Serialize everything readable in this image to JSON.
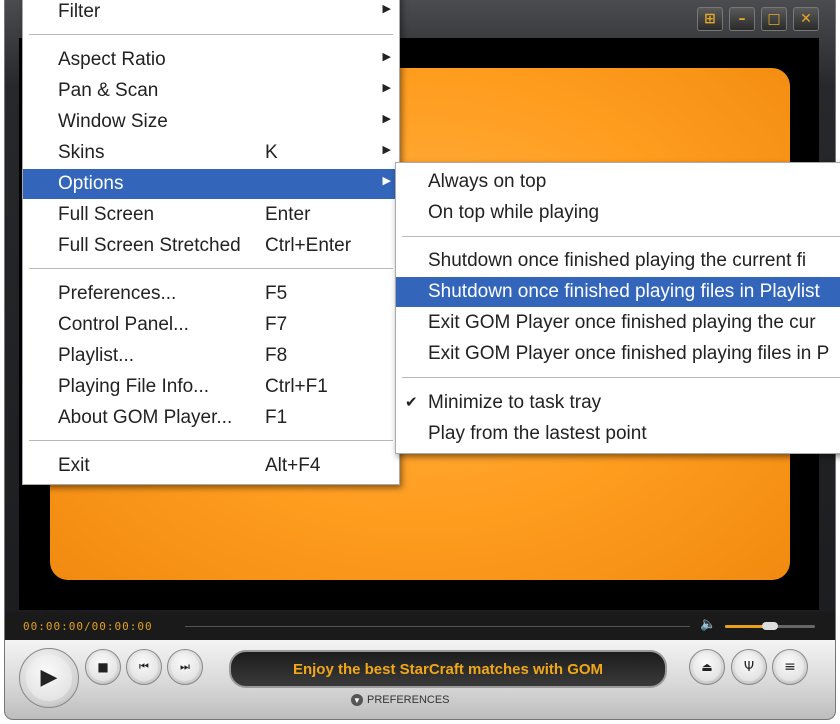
{
  "menu": {
    "items": [
      {
        "label": "Filter",
        "shortcut": "",
        "submenu": true
      },
      {
        "label": "Aspect Ratio",
        "shortcut": "",
        "submenu": true
      },
      {
        "label": "Pan & Scan",
        "shortcut": "",
        "submenu": true
      },
      {
        "label": "Window Size",
        "shortcut": "",
        "submenu": true
      },
      {
        "label": "Skins",
        "shortcut": "K",
        "submenu": true
      },
      {
        "label": "Options",
        "shortcut": "",
        "submenu": true,
        "highlighted": true
      },
      {
        "label": "Full Screen",
        "shortcut": "Enter"
      },
      {
        "label": "Full Screen Stretched",
        "shortcut": "Ctrl+Enter"
      },
      {
        "label": "Preferences...",
        "shortcut": "F5"
      },
      {
        "label": "Control Panel...",
        "shortcut": "F7"
      },
      {
        "label": "Playlist...",
        "shortcut": "F8"
      },
      {
        "label": "Playing File Info...",
        "shortcut": "Ctrl+F1"
      },
      {
        "label": "About GOM Player...",
        "shortcut": "F1"
      },
      {
        "label": "Exit",
        "shortcut": "Alt+F4"
      }
    ]
  },
  "submenu": {
    "items": [
      {
        "label": "Always on top"
      },
      {
        "label": "On top while playing"
      },
      {
        "label": "Shutdown once finished playing the current fi"
      },
      {
        "label": "Shutdown once finished playing files in Playlist",
        "highlighted": true
      },
      {
        "label": "Exit GOM Player once finished playing the cur"
      },
      {
        "label": "Exit GOM Player once finished playing files in P"
      },
      {
        "label": "Minimize to task tray",
        "checked": true
      },
      {
        "label": "Play from the lastest point"
      }
    ]
  },
  "player": {
    "timecode": "00:00:00/00:00:00",
    "marquee": "Enjoy the best StarCraft matches with GOM",
    "preferences_label": "PREFERENCES",
    "volume_fraction": 0.5
  },
  "icons": {
    "check": "✔",
    "arrow": "▶",
    "play": "▶",
    "stop": "■",
    "prev": "⏮",
    "next": "⏭",
    "eject": "⏏",
    "equalizer": "Ψ",
    "playlist": "≡",
    "volume": "🔈",
    "win_fit": "⊞",
    "win_min": "–",
    "win_max": "□",
    "win_close": "✕"
  },
  "colors": {
    "highlight": "#3366bb",
    "accent": "#f0a818",
    "video": "#ff9d1f"
  }
}
